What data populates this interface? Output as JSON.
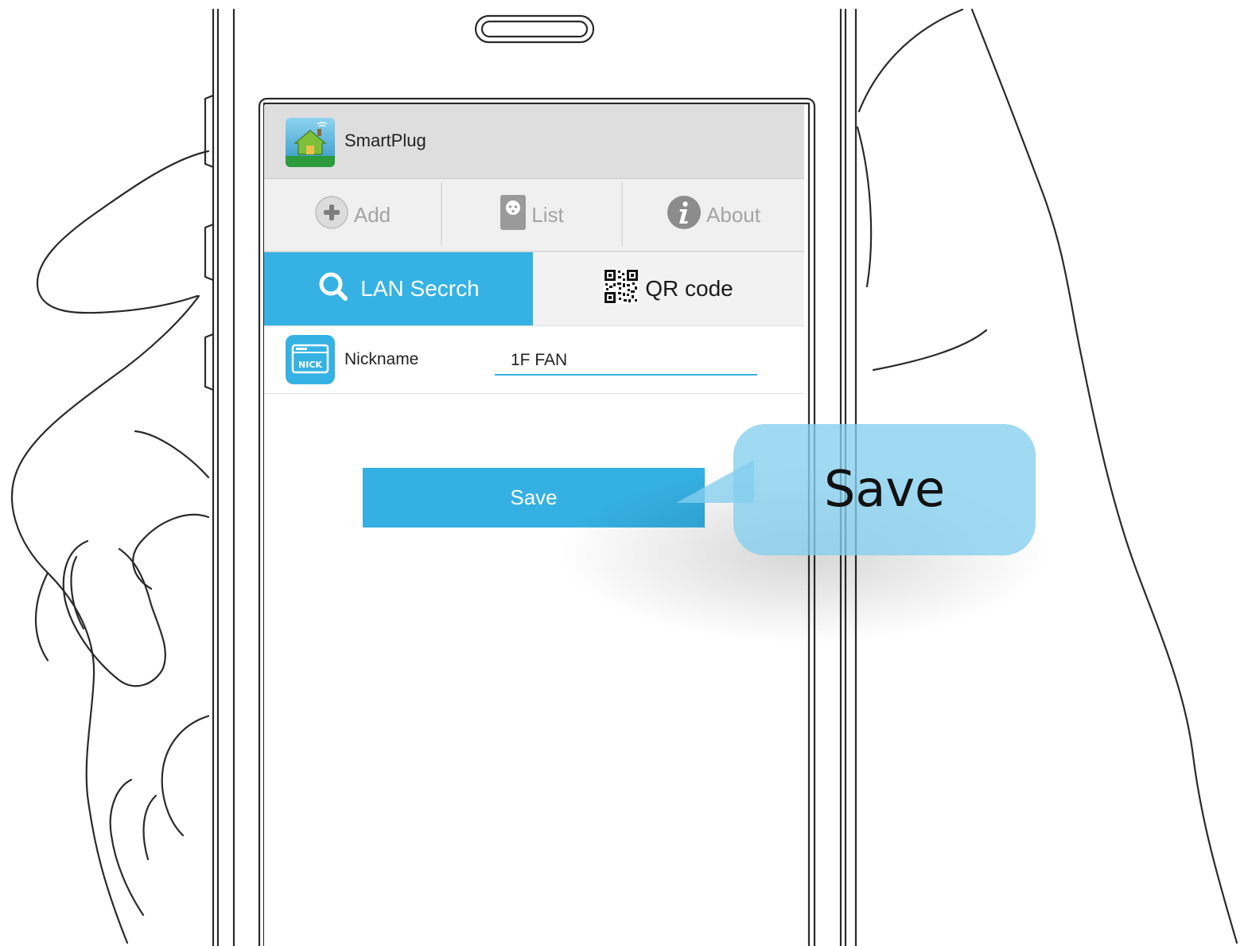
{
  "app": {
    "title": "SmartPlug",
    "icon": "smart-home-app-icon"
  },
  "nav": {
    "items": [
      {
        "label": "Add",
        "icon": "plus-circle-icon"
      },
      {
        "label": "List",
        "icon": "socket-icon"
      },
      {
        "label": "About",
        "icon": "info-icon"
      }
    ]
  },
  "subtabs": [
    {
      "label": "LAN Secrch",
      "icon": "search-icon",
      "active": true
    },
    {
      "label": "QR code",
      "icon": "qr-code-icon",
      "active": false
    }
  ],
  "nickname": {
    "label": "Nickname",
    "value": "1F FAN",
    "icon": "nick-icon"
  },
  "save_button": {
    "label": "Save"
  },
  "callout": {
    "text": "Save"
  },
  "colors": {
    "accent": "#35b2e3",
    "titlebar": "#dedede",
    "callout": "#84ceee"
  }
}
